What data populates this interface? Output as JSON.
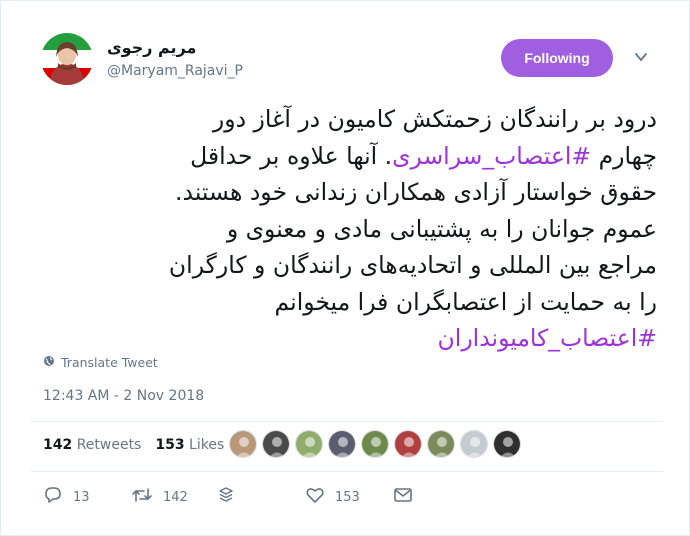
{
  "author": {
    "name": "مریم رجوی",
    "handle": "@Maryam_Rajavi_P"
  },
  "follow_button": {
    "label": "Following"
  },
  "tweet": {
    "lines": [
      {
        "text": "درود بر رانندگان زحمتکش کامیون در آغاز دور"
      },
      {
        "prefix": "چهارم ",
        "hashtag": "#اعتصاب_سراسری",
        "suffix": ". آنها علاوه بر حداقل"
      },
      {
        "text": "حقوق خواستار آزادی همکاران زندانی خود هستند."
      },
      {
        "text": "عموم جوانان را به پشتیبانی مادی و معنوی و"
      },
      {
        "text": "مراجع بین المللی و اتحادیه‌های رانندگان و کارگران"
      },
      {
        "text": "را به حمایت از اعتصابگران فرا میخوانم"
      },
      {
        "hashtag": "#اعتصاب_کامیونداران"
      }
    ]
  },
  "translate_label": "Translate Tweet",
  "timestamp": "12:43 AM - 2 Nov 2018",
  "stats": {
    "retweets_count": "142",
    "retweets_label": "Retweets",
    "likes_count": "153",
    "likes_label": "Likes"
  },
  "liker_avatars": [
    {
      "color": "#b89878"
    },
    {
      "color": "#4a4a4a"
    },
    {
      "color": "#8fae6b"
    },
    {
      "color": "#5c5c70"
    },
    {
      "color": "#6d8a4d"
    },
    {
      "color": "#b04040"
    },
    {
      "color": "#7a8a5a"
    },
    {
      "color": "#c5cbd1"
    },
    {
      "color": "#2f2f2f"
    }
  ],
  "actions": {
    "reply_count": "13",
    "retweet_count": "142",
    "like_count": "153"
  },
  "colors": {
    "accent": "#a05ee0",
    "hashtag": "#9b33d9",
    "muted": "#657786"
  }
}
